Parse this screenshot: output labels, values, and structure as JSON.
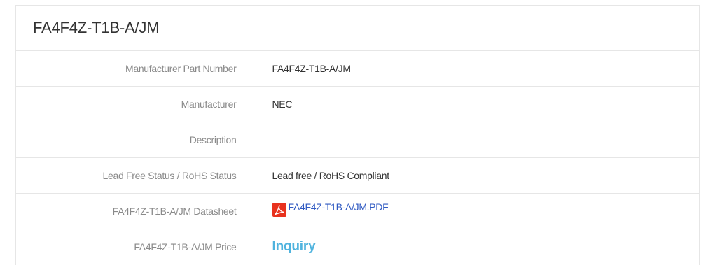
{
  "part": {
    "title": "FA4F4Z-T1B-A/JM"
  },
  "specs": [
    {
      "label": "Manufacturer Part Number",
      "value": "FA4F4Z-T1B-A/JM"
    },
    {
      "label": "Manufacturer",
      "value": "NEC"
    },
    {
      "label": "Description",
      "value": ""
    },
    {
      "label": "Lead Free Status / RoHS Status",
      "value": "Lead free / RoHS Compliant"
    }
  ],
  "datasheet": {
    "label": "FA4F4Z-T1B-A/JM Datasheet",
    "link_text": "FA4F4Z-T1B-A/JM.PDF",
    "icon": "pdf-icon",
    "icon_color": "#e8321e"
  },
  "price": {
    "label": "FA4F4Z-T1B-A/JM Price",
    "link_text": "Inquiry",
    "link_color": "#4fb3de"
  },
  "colors": {
    "border": "#e6e6e6",
    "label_text": "#8a8a8a",
    "value_text": "#333333",
    "link": "#2f59c2"
  }
}
